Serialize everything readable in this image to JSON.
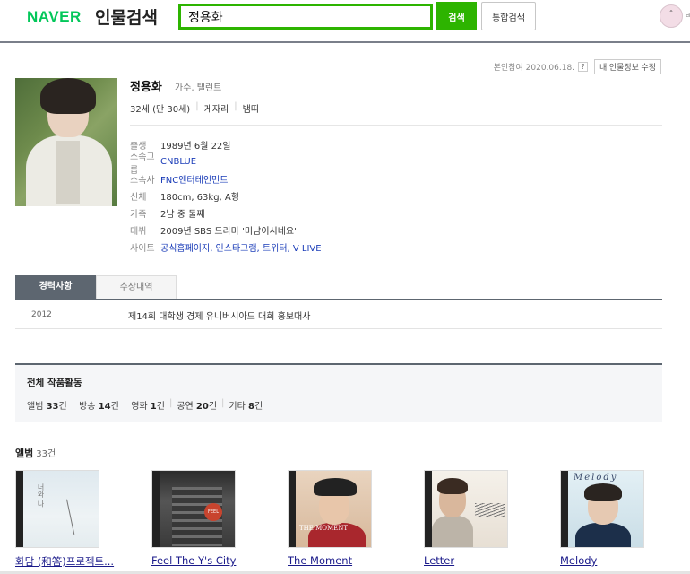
{
  "header": {
    "logo": "NAVER",
    "logo_sub": "인물검색",
    "search_value": "정용화",
    "search_button": "검색",
    "total_search_button": "통합검색",
    "avatar_glyph": "ˆ",
    "trailing_text": "a"
  },
  "profile": {
    "ref_text": "본인참여 2020.06.18.",
    "help_glyph": "?",
    "edit_button": "내 인물정보 수정",
    "name": "정용화",
    "job": "가수, 탤런트",
    "tags": [
      "32세 (만 30세)",
      "게자리",
      "뱀띠"
    ],
    "info": [
      {
        "label": "출생",
        "value": "1989년 6월 22일",
        "link": false
      },
      {
        "label": "소속그룹",
        "value": "CNBLUE",
        "link": true
      },
      {
        "label": "소속사",
        "value": "FNC엔터테인먼트",
        "link": true
      },
      {
        "label": "신체",
        "value": "180cm, 63kg, A형",
        "link": false
      },
      {
        "label": "가족",
        "value": "2남 중 둘째",
        "link": false
      },
      {
        "label": "데뷔",
        "value": "2009년 SBS 드라마 '미남이시네요'",
        "link": false
      },
      {
        "label": "사이트",
        "value": "공식홈페이지, 인스타그램, 트위터, V LIVE",
        "link": true
      }
    ]
  },
  "tabs": {
    "active": "경력사항",
    "inactive": "수상내역"
  },
  "career": [
    {
      "year": "2012",
      "desc": "제14회 대학생 경제 유니버시아드 대회 홍보대사"
    }
  ],
  "works": {
    "title": "전체 작품활동",
    "stats": [
      {
        "label": "앨범",
        "count": "33",
        "unit": "건"
      },
      {
        "label": "방송",
        "count": "14",
        "unit": "건"
      },
      {
        "label": "영화",
        "count": "1",
        "unit": "건"
      },
      {
        "label": "공연",
        "count": "20",
        "unit": "건"
      },
      {
        "label": "기타",
        "count": "8",
        "unit": "건"
      }
    ]
  },
  "albums": {
    "heading": "앨범",
    "count": "33건",
    "items": [
      {
        "title": "화담 (和答)프로젝트..."
      },
      {
        "title": "Feel The Y's City"
      },
      {
        "title": "The Moment"
      },
      {
        "title": "Letter"
      },
      {
        "title": "Melody"
      }
    ],
    "cover_texts": {
      "c1": "너와 나",
      "c2": "FEEL",
      "c3": "THE MOMENT",
      "c5": "Melody"
    }
  }
}
